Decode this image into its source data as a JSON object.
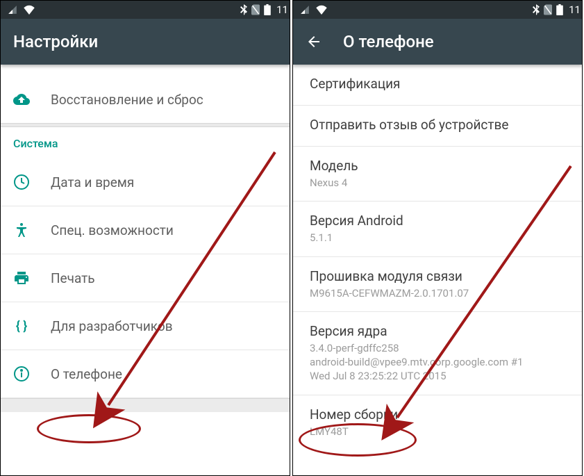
{
  "left": {
    "status": {
      "time": "11"
    },
    "app_bar": {
      "title": "Настройки"
    },
    "backup_label": "Восстановление и сброс",
    "section_system": "Система",
    "date_time_label": "Дата и время",
    "accessibility_label": "Спец. возможности",
    "print_label": "Печать",
    "developer_label": "Для разработчиков",
    "about_phone_label": "О телефоне"
  },
  "right": {
    "status": {
      "time": "11"
    },
    "app_bar": {
      "title": "О телефоне"
    },
    "cert_label": "Сертификация",
    "feedback_label": "Отправить отзыв об устройстве",
    "model": {
      "title": "Модель",
      "value": "Nexus 4"
    },
    "android_version": {
      "title": "Версия Android",
      "value": "5.1.1"
    },
    "baseband": {
      "title": "Прошивка модуля связи",
      "value": "M9615A-CEFWMAZM-2.0.1701.07"
    },
    "kernel": {
      "title": "Версия ядра",
      "line1": "3.4.0-perf-gdffc258",
      "line2": "android-build@vpee9.mtv.corp.google.com #1",
      "line3": "Wed Jul 8 23:25:22 UTC 2015"
    },
    "build": {
      "title": "Номер сборки",
      "value": "LMY48T"
    }
  }
}
